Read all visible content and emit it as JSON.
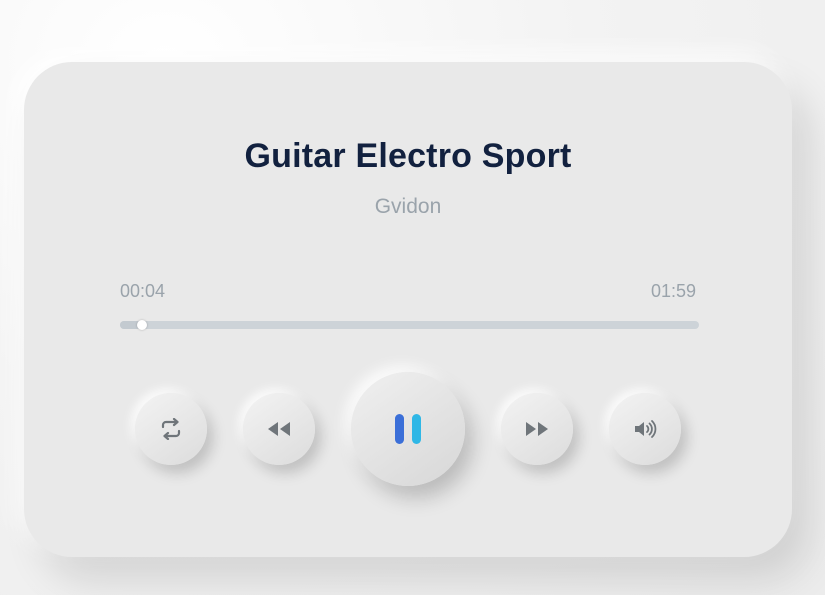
{
  "track": {
    "title": "Guitar Electro Sport",
    "artist": "Gvidon"
  },
  "playback": {
    "current_time": "00:04",
    "total_time": "01:59",
    "progress_percent": 3.4,
    "state": "playing"
  },
  "controls": {
    "repeat_icon": "repeat-icon",
    "rewind_icon": "rewind-icon",
    "pause_icon": "pause-icon",
    "forward_icon": "fast-forward-icon",
    "volume_icon": "volume-icon"
  },
  "colors": {
    "title": "#12213f",
    "muted_text": "#9aa3ab",
    "track": "#cdd3d8",
    "pause_gradient_start": "#3b6fd8",
    "pause_gradient_end": "#2fb7e6",
    "icon_gray": "#6f757a"
  }
}
